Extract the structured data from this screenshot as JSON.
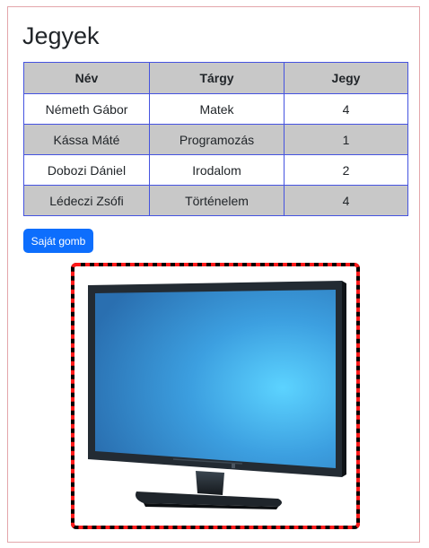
{
  "page": {
    "title": "Jegyek"
  },
  "table": {
    "headers": [
      "Név",
      "Tárgy",
      "Jegy"
    ],
    "rows": [
      [
        "Németh Gábor",
        "Matek",
        "4"
      ],
      [
        "Kássa Máté",
        "Programozás",
        "1"
      ],
      [
        "Dobozi Dániel",
        "Irodalom",
        "2"
      ],
      [
        "Lédeczi Zsófi",
        "Történelem",
        "4"
      ]
    ]
  },
  "button": {
    "label": "Saját gomb"
  },
  "colors": {
    "button": "#0d6efd",
    "table_border": "#4553e0",
    "header_bg": "#c8c8c8",
    "frame_border": "#e3a6ab",
    "image_border_dash": "#ff1a1a"
  },
  "image": {
    "subject": "monitor-image"
  }
}
